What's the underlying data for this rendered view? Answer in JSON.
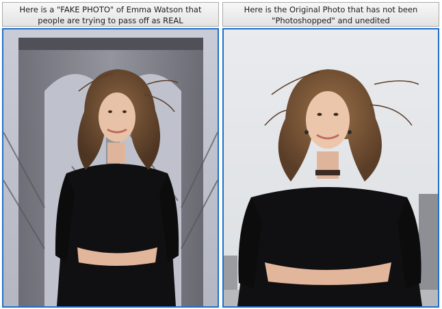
{
  "panels": [
    {
      "caption_line1": "Here is a \"FAKE PHOTO\" of Emma Watson that",
      "caption_line2": "people are trying to pass off as REAL",
      "image": "edited photo: woman in black top with windblown hair in front of a bridge tower"
    },
    {
      "caption_line1": "Here is the Original Photo that has not been",
      "caption_line2": "\"Photoshopped\" and unedited",
      "image": "original photo: woman in black top with windblown hair against a pale sky"
    }
  ],
  "colors": {
    "frame_border": "#1e6fc9",
    "caption_bg": "#ececec",
    "clothing": "#0f0f10",
    "hair": "#6b4a2f",
    "skin": "#e7bfa3"
  }
}
